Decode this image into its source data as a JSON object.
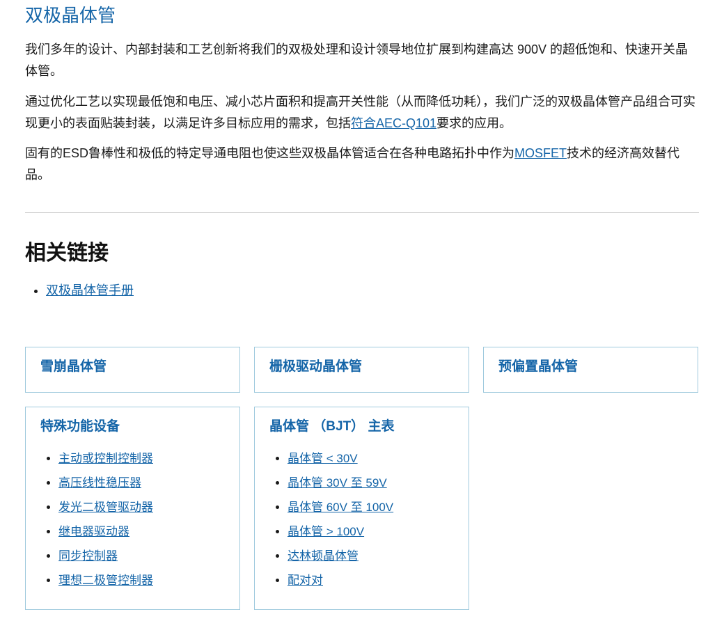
{
  "section": {
    "title": "双极晶体管",
    "p1": "我们多年的设计、内部封装和工艺创新将我们的双极处理和设计领导地位扩展到构建高达 900V 的超低饱和、快速开关晶体管。",
    "p2_before": "通过优化工艺以实现最低饱和电压、减小芯片面积和提高开关性能（从而降低功耗），我们广泛的双极晶体管产品组合可实现更小的表面贴装封装，以满足许多目标应用的需求，包括",
    "p2_link": "符合AEC-Q101",
    "p2_after": "要求的应用。",
    "p3_before": "固有的ESD鲁棒性和极低的特定导通电阻也使这些双极晶体管适合在各种电路拓扑中作为",
    "p3_link": "MOSFET",
    "p3_after": "技术的经济高效替代品。"
  },
  "related": {
    "title": "相关链接",
    "links": [
      "双极晶体管手册"
    ]
  },
  "cards": [
    {
      "title": "雪崩晶体管"
    },
    {
      "title": "栅极驱动晶体管"
    },
    {
      "title": "预偏置晶体管"
    },
    {
      "title": "特殊功能设备",
      "items": [
        "主动或控制控制器",
        "高压线性稳压器",
        "发光二极管驱动器",
        "继电器驱动器",
        "同步控制器",
        "理想二极管控制器"
      ]
    },
    {
      "title": "晶体管 （BJT） 主表",
      "items": [
        "晶体管 < 30V",
        "晶体管 30V 至 59V",
        "晶体管 60V 至 100V",
        "晶体管 > 100V",
        "达林顿晶体管",
        "配对对"
      ]
    }
  ],
  "colors": {
    "accent": "#1565a8",
    "card_border": "#9ec9dd",
    "divider": "#c8c8c8"
  }
}
